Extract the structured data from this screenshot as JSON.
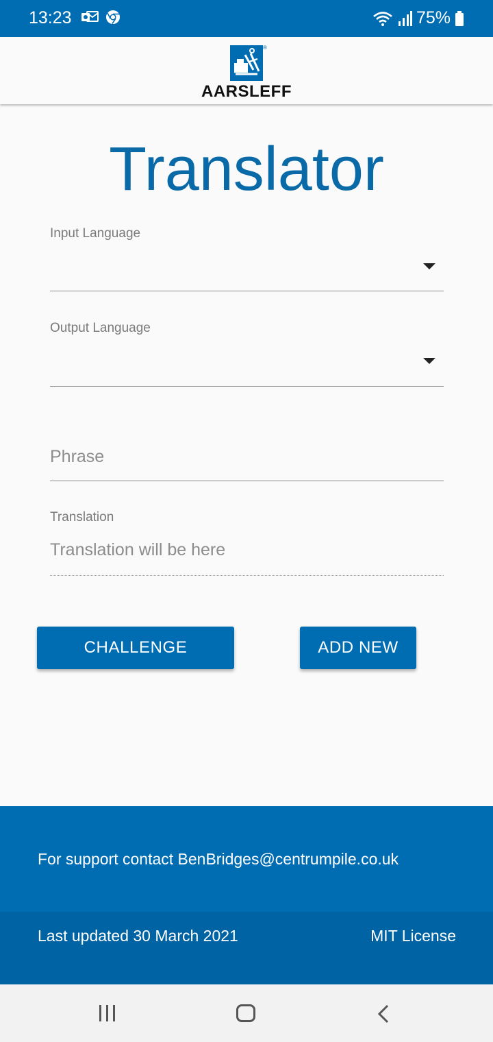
{
  "status_bar": {
    "time": "13:23",
    "battery": "75%",
    "icons": [
      "outlook-icon",
      "chrome-icon",
      "wifi-icon",
      "signal-icon",
      "battery-icon"
    ]
  },
  "header": {
    "logo_text": "AARSLEFF",
    "logo_registered": "®"
  },
  "main": {
    "title": "Translator",
    "input_language": {
      "label": "Input Language",
      "value": ""
    },
    "output_language": {
      "label": "Output Language",
      "value": ""
    },
    "phrase": {
      "placeholder": "Phrase",
      "value": ""
    },
    "translation": {
      "label": "Translation",
      "placeholder": "Translation will be here"
    },
    "buttons": {
      "challenge": "CHALLENGE",
      "add_new": "ADD NEW"
    }
  },
  "footer": {
    "support": "For support contact BenBridges@centrumpile.co.uk",
    "last_updated": "Last updated 30 March 2021",
    "license": "MIT License"
  },
  "colors": {
    "primary": "#006db3",
    "title": "#0a6aa8",
    "background": "#fafafa"
  }
}
